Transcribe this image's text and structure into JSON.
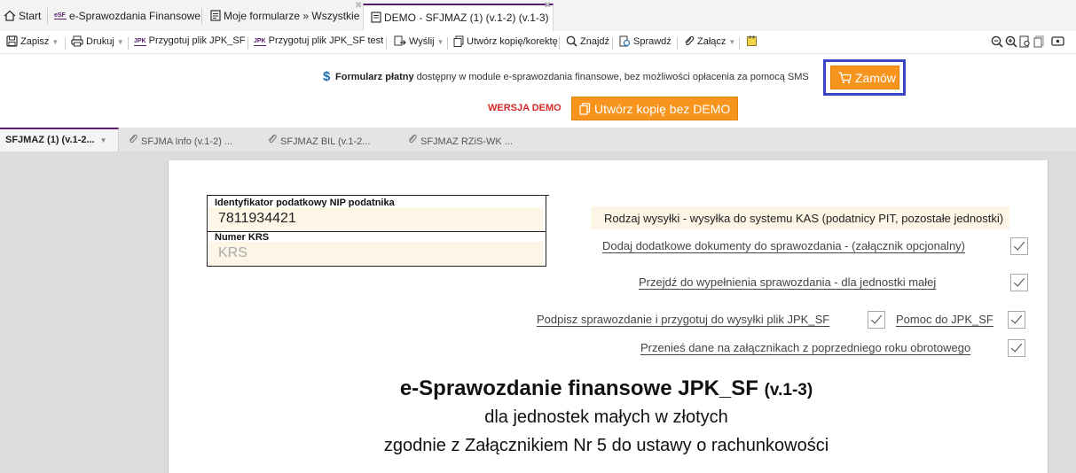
{
  "tabs": [
    {
      "label": "Start",
      "icon": "home-icon"
    },
    {
      "label": "e-Sprawozdania Finansowe",
      "icon": "esf-icon"
    },
    {
      "label": "Moje formularze » Wszystkie",
      "icon": "forms-icon"
    },
    {
      "label": "DEMO - SFJMAZ (1) (v.1-2) (v.1-3)",
      "icon": "document-icon",
      "active": true
    }
  ],
  "toolbar": {
    "save": "Zapisz",
    "print": "Drukuj",
    "prepare_jpk": "Przygotuj plik JPK_SF",
    "prepare_jpk_test": "Przygotuj plik JPK_SF test",
    "send": "Wyślij",
    "copy": "Utwórz kopię/korektę",
    "find": "Znajdź",
    "check": "Sprawdź",
    "attach": "Załącz",
    "jpk_badge": "JPK"
  },
  "banner": {
    "currency_symbol": "$",
    "paid_bold": "Formularz płatny",
    "paid_rest": " dostępny w module e-sprawozdania finansowe, bez możliwości opłacenia za pomocą SMS",
    "order_label": "Zamów",
    "demo_label": "WERSJA DEMO",
    "copy_no_demo_label": "Utwórz kopię bez DEMO"
  },
  "form_tabs": [
    {
      "label": "SFJMAZ (1) (v.1-2...",
      "active": true
    },
    {
      "label": "SFJMA Info (v.1-2) ..."
    },
    {
      "label": "SFJMAZ BIL (v.1-2..."
    },
    {
      "label": "SFJMAZ RZiS-WK ..."
    }
  ],
  "form": {
    "nip_label": "Identyfikator podatkowy NIP podatnika",
    "nip_value": "7811934421",
    "krs_label": "Numer KRS",
    "krs_placeholder": "KRS",
    "send_type": "Rodzaj wysyłki - wysyłka do systemu KAS (podatnicy PIT, pozostałe jednostki)",
    "links": {
      "add_docs": "Dodaj dodatkowe dokumenty do sprawozdania - (załącznik opcjonalny)",
      "go_fill": "Przejdź do wypełnienia sprawozdania - dla jednostki małej",
      "sign": "Podpisz sprawozdanie i przygotuj do wysyłki plik JPK_SF",
      "help": "Pomoc do JPK_SF",
      "transfer": "Przenieś dane na załącznikach z poprzedniego roku obrotowego"
    },
    "title": "e-Sprawozdanie finansowe JPK_SF",
    "title_version": "(v.1-3)",
    "subtitle1": "dla jednostek małych w złotych",
    "subtitle2": "zgodnie z Załącznikiem Nr 5 do ustawy o rachunkowości"
  },
  "colors": {
    "accent": "#5a1e6f",
    "orange": "#f7941d",
    "highlight_frame": "#3b44c4",
    "demo_red": "#d62828",
    "field_bg": "#fdf5e6"
  }
}
